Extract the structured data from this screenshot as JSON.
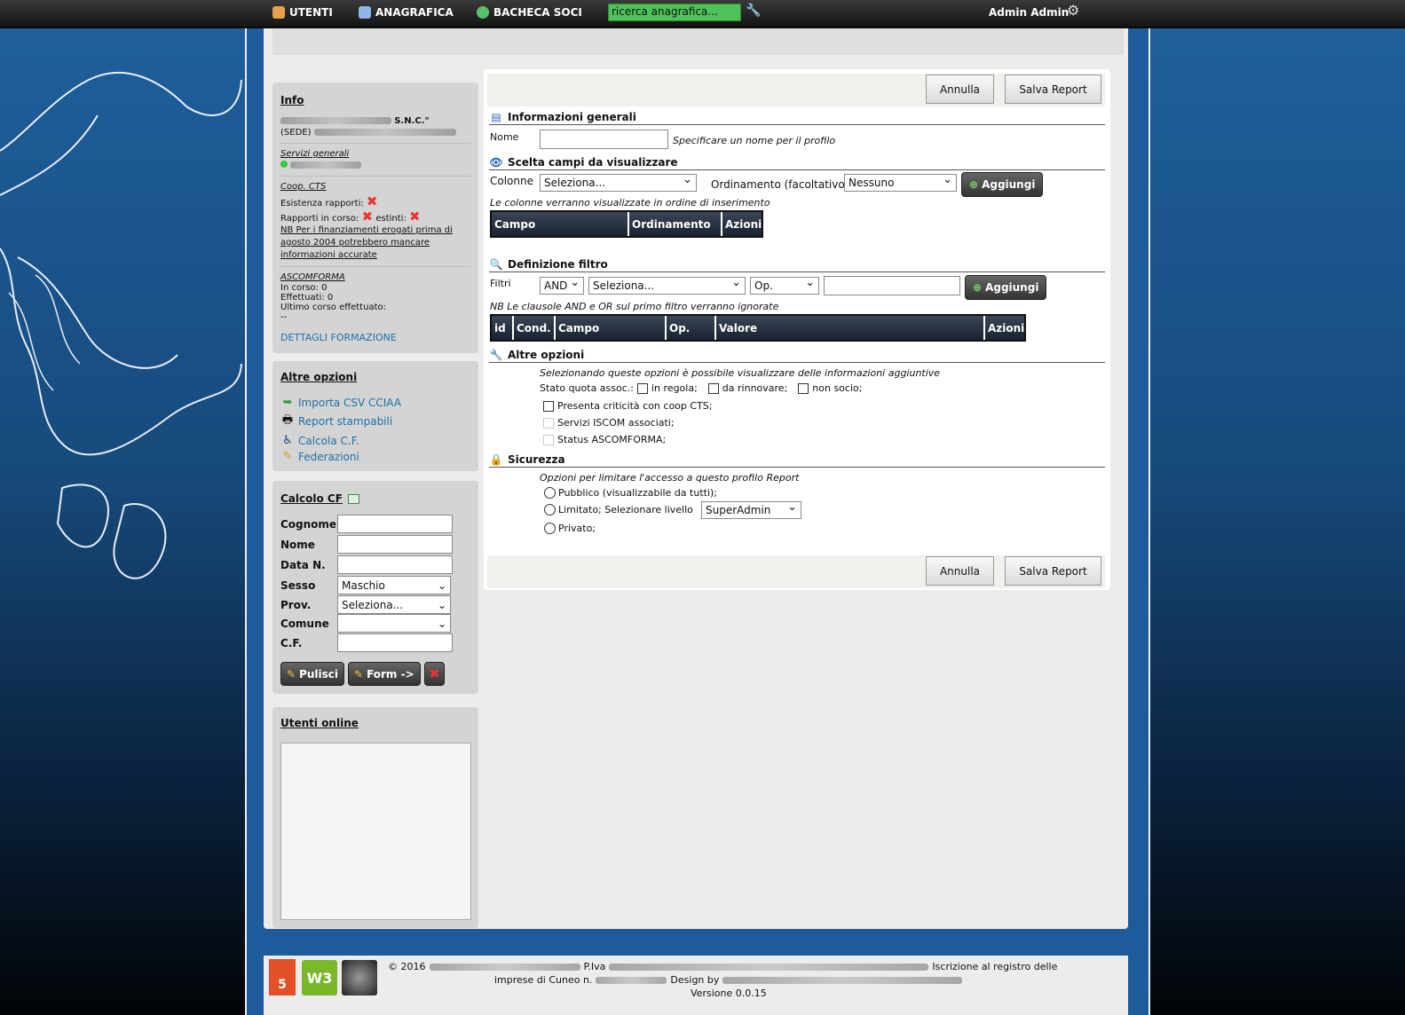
{
  "nav": {
    "users": "UTENTI",
    "registry": "ANAGRAFICA",
    "board": "BACHECA SOCI",
    "search_value": "ricerca anagrafica...",
    "admin": "Admin Admin"
  },
  "info": {
    "title": "Info",
    "company_suffix": "S.N.C.\"",
    "seat": "(SEDE)",
    "general_services": "Servizi generali",
    "coop_cts": "Coop. CTS",
    "reports_exist": "Esistenza rapporti:",
    "reports_ongoing": "Rapporti in corso:",
    "reports_closed": "estinti:",
    "note": "NB Per i finanziamenti erogati prima di agosto 2004 potrebbero mancare informazioni accurate",
    "ascomforma": "ASCOMFORMA",
    "in_progress": "In corso: 0",
    "done": "Effettuati: 0",
    "last_course": "Ultimo corso effettuato:",
    "last_course_value": "--",
    "training_link": "DETTAGLI FORMAZIONE"
  },
  "other": {
    "title": "Altre opzioni",
    "items": [
      "Importa CSV CCIAA",
      "Report stampabili",
      "Calcola C.F.",
      "Federazioni"
    ]
  },
  "cf": {
    "title": "Calcolo CF",
    "labels": [
      "Cognome",
      "Nome",
      "Data N.",
      "Sesso",
      "Prov.",
      "Comune",
      "C.F."
    ],
    "sesso_value": "Maschio",
    "prov_value": "Seleziona...",
    "btn_clear": "Pulisci",
    "btn_form": "Form ->"
  },
  "online": {
    "title": "Utenti online"
  },
  "form": {
    "cancel": "Annulla",
    "save": "Salva Report",
    "general_title": "Informazioni generali",
    "name_label": "Nome",
    "name_hint": "Specificare un nome per il profilo",
    "fields_title": "Scelta campi da visualizzare",
    "columns_label": "Colonne",
    "columns_value": "Seleziona...",
    "order_label": "Ordinamento (facoltativo)",
    "order_value": "Nessuno",
    "add": "Aggiungi",
    "columns_note": "Le colonne verranno visualizzate in ordine di inserimento",
    "columns_table": [
      "Campo",
      "Ordinamento",
      "Azioni"
    ],
    "filter_title": "Definizione filtro",
    "filters_label": "Filtri",
    "filter_cond": "AND",
    "filter_field": "Seleziona...",
    "filter_op": "Op.",
    "filter_note": "NB Le clausole AND e OR sul primo filtro verranno ignorate",
    "filter_table": [
      "id",
      "Cond.",
      "Campo",
      "Op.",
      "Valore",
      "Azioni"
    ],
    "other_title": "Altre opzioni",
    "other_note": "Selezionando queste opzioni è possibile visualizzare delle informazioni aggiuntive",
    "quota_label": "Stato quota assoc.:",
    "quota_opts": [
      "in regola;",
      "da rinnovare;",
      "non socio;"
    ],
    "crit": "Presenta criticità con coop CTS;",
    "iscom": "Servizi ISCOM associati;",
    "ascom": "Status ASCOMFORMA;",
    "security_title": "Sicurezza",
    "security_note": "Opzioni per limitare l'accesso a questo profilo Report",
    "public": "Pubblico (visualizzabile da tutti);",
    "limited": "Limitato; Selezionare livello",
    "level_value": "SuperAdmin",
    "private": "Privato;"
  },
  "footer": {
    "copy": "© 2016",
    "piva": "P.Iva",
    "reg": "Iscrizione al registro delle",
    "imprese": "imprese di Cuneo n.",
    "design": "Design by",
    "version": "Versione 0.0.15"
  }
}
